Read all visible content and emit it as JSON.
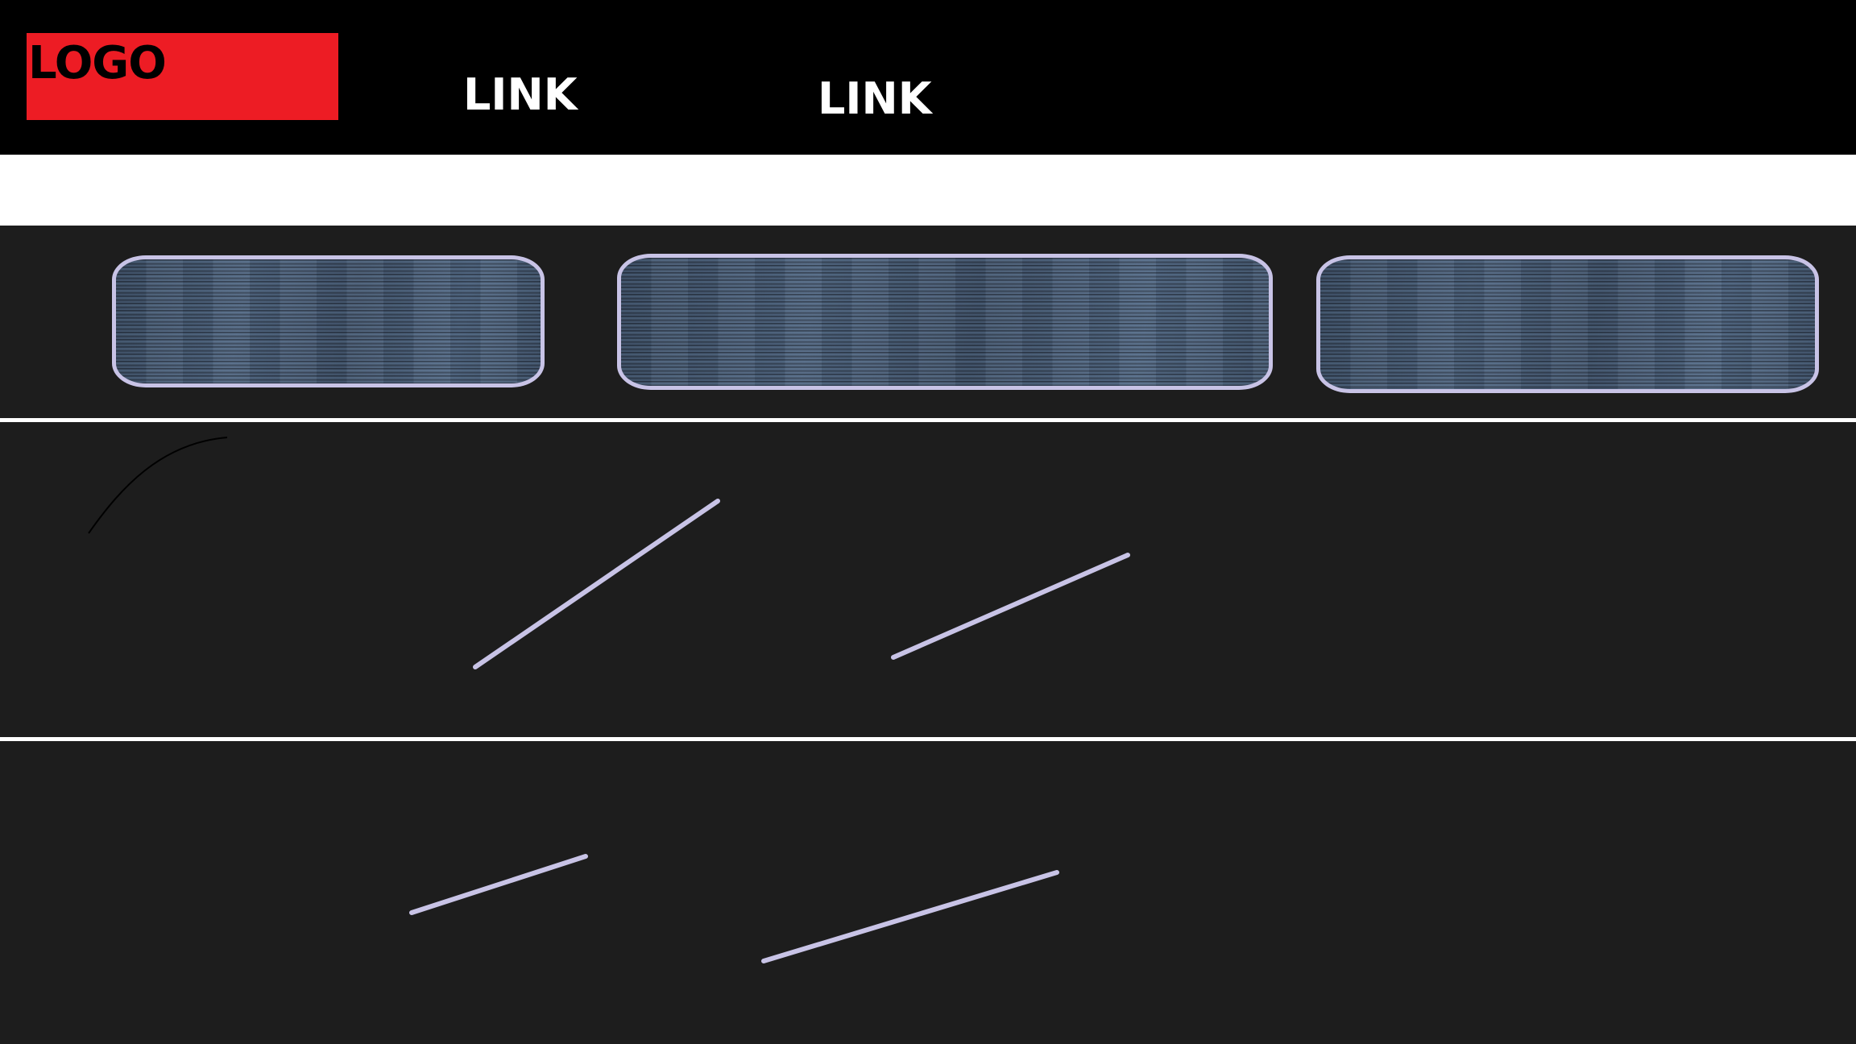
{
  "header": {
    "logo_text": "LOGO",
    "nav_links": [
      {
        "label": "LINK"
      },
      {
        "label": "LINK"
      }
    ]
  },
  "colors": {
    "header_background": "#000000",
    "logo_background": "#ed1c24",
    "band_background": "#ffffff",
    "page_background": "#1d1d1d",
    "card_border": "#c8c3e6",
    "card_fill": "#46576e",
    "placeholder_line": "#c8c3e6"
  },
  "cards": [
    {
      "icon": "textured-placeholder"
    },
    {
      "icon": "textured-placeholder"
    },
    {
      "icon": "textured-placeholder"
    }
  ]
}
